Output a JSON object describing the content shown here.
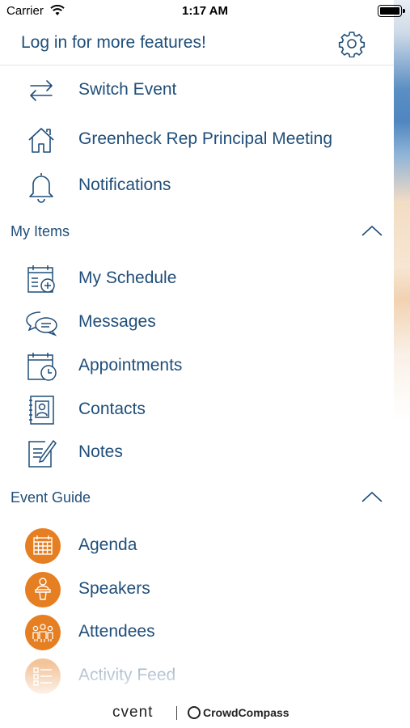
{
  "status_bar": {
    "carrier": "Carrier",
    "time": "1:17 AM"
  },
  "header": {
    "login_text": "Log in for more features!",
    "settings_icon": "gear-icon"
  },
  "top_items": [
    {
      "label": "Switch Event",
      "icon": "switch-arrows-icon"
    },
    {
      "label": "Greenheck Rep Principal Meeting",
      "icon": "home-icon"
    },
    {
      "label": "Notifications",
      "icon": "bell-icon"
    }
  ],
  "my_items": {
    "title": "My Items",
    "items": [
      {
        "label": "My Schedule",
        "icon": "schedule-add-icon"
      },
      {
        "label": "Messages",
        "icon": "chat-bubbles-icon"
      },
      {
        "label": "Appointments",
        "icon": "calendar-clock-icon"
      },
      {
        "label": "Contacts",
        "icon": "contact-book-icon"
      },
      {
        "label": "Notes",
        "icon": "note-pencil-icon"
      }
    ]
  },
  "event_guide": {
    "title": "Event Guide",
    "items": [
      {
        "label": "Agenda",
        "icon": "agenda-grid-icon"
      },
      {
        "label": "Speakers",
        "icon": "speaker-podium-icon"
      },
      {
        "label": "Attendees",
        "icon": "attendees-group-icon"
      },
      {
        "label": "Activity Feed",
        "icon": "activity-feed-icon"
      }
    ]
  },
  "footer": {
    "brand": "cvent",
    "partner": "CrowdCompass"
  },
  "colors": {
    "text": "#1f4e79",
    "accent_orange": "#e67e22",
    "divider": "#e3e6ea"
  }
}
